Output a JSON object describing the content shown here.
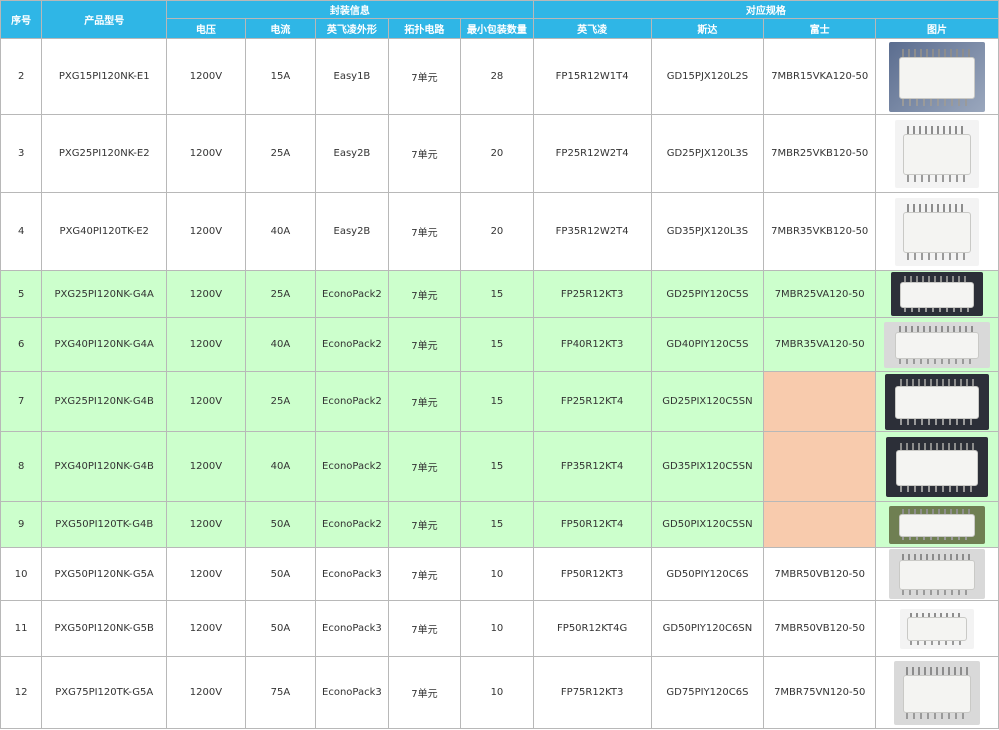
{
  "headers": {
    "no": "序号",
    "model": "产品型号",
    "package_info": "封装信息",
    "corresponding_specs": "对应规格",
    "voltage": "电压",
    "current": "电流",
    "infineon_package": "英飞凌外形",
    "topology": "拓扑电路",
    "min_pack_qty": "最小包装数量",
    "infineon": "英飞凌",
    "starpower": "斯达",
    "fuji": "富士",
    "picture": "图片"
  },
  "rows": [
    {
      "no": "2",
      "model": "PXG15PI120NK-E1",
      "voltage": "1200V",
      "current": "15A",
      "package": "Easy1B",
      "topology": "7单元",
      "qty": "28",
      "infineon": "FP15R12W1T4",
      "starpower": "GD15PJX120L2S",
      "fuji": "7MBR15VKA120-50",
      "image": "igbt-module-easy1b-photo"
    },
    {
      "no": "3",
      "model": "PXG25PI120NK-E2",
      "voltage": "1200V",
      "current": "25A",
      "package": "Easy2B",
      "topology": "7单元",
      "qty": "20",
      "infineon": "FP25R12W2T4",
      "starpower": "GD25PJX120L3S",
      "fuji": "7MBR25VKB120-50",
      "image": "igbt-module-easy2b-photo"
    },
    {
      "no": "4",
      "model": "PXG40PI120TK-E2",
      "voltage": "1200V",
      "current": "40A",
      "package": "Easy2B",
      "topology": "7单元",
      "qty": "20",
      "infineon": "FP35R12W2T4",
      "starpower": "GD35PJX120L3S",
      "fuji": "7MBR35VKB120-50",
      "image": "igbt-module-easy2b-photo"
    },
    {
      "no": "5",
      "model": "PXG25PI120NK-G4A",
      "voltage": "1200V",
      "current": "25A",
      "package": "EconoPack2",
      "topology": "7单元",
      "qty": "15",
      "infineon": "FP25R12KT3",
      "starpower": "GD25PIY120C5S",
      "fuji": "7MBR25VA120-50",
      "image": "igbt-module-econopack2-photo"
    },
    {
      "no": "6",
      "model": "PXG40PI120NK-G4A",
      "voltage": "1200V",
      "current": "40A",
      "package": "EconoPack2",
      "topology": "7单元",
      "qty": "15",
      "infineon": "FP40R12KT3",
      "starpower": "GD40PIY120C5S",
      "fuji": "7MBR35VA120-50",
      "image": "igbt-module-econopack2-photo"
    },
    {
      "no": "7",
      "model": "PXG25PI120NK-G4B",
      "voltage": "1200V",
      "current": "25A",
      "package": "EconoPack2",
      "topology": "7单元",
      "qty": "15",
      "infineon": "FP25R12KT4",
      "starpower": "GD25PIX120C5SN",
      "fuji": "",
      "image": "igbt-module-econopack2-photo"
    },
    {
      "no": "8",
      "model": "PXG40PI120NK-G4B",
      "voltage": "1200V",
      "current": "40A",
      "package": "EconoPack2",
      "topology": "7单元",
      "qty": "15",
      "infineon": "FP35R12KT4",
      "starpower": "GD35PIX120C5SN",
      "fuji": "",
      "image": "igbt-module-econopack2-photo"
    },
    {
      "no": "9",
      "model": "PXG50PI120TK-G4B",
      "voltage": "1200V",
      "current": "50A",
      "package": "EconoPack2",
      "topology": "7单元",
      "qty": "15",
      "infineon": "FP50R12KT4",
      "starpower": "GD50PIX120C5SN",
      "fuji": "",
      "image": "igbt-module-econopack2-photo"
    },
    {
      "no": "10",
      "model": "PXG50PI120NK-G5A",
      "voltage": "1200V",
      "current": "50A",
      "package": "EconoPack3",
      "topology": "7单元",
      "qty": "10",
      "infineon": "FP50R12KT3",
      "starpower": "GD50PIY120C6S",
      "fuji": "7MBR50VB120-50",
      "image": "igbt-module-econopack3-photo"
    },
    {
      "no": "11",
      "model": "PXG50PI120NK-G5B",
      "voltage": "1200V",
      "current": "50A",
      "package": "EconoPack3",
      "topology": "7单元",
      "qty": "10",
      "infineon": "FP50R12KT4G",
      "starpower": "GD50PIY120C6SN",
      "fuji": "7MBR50VB120-50",
      "image": "igbt-module-econopack3-photo"
    },
    {
      "no": "12",
      "model": "PXG75PI120TK-G5A",
      "voltage": "1200V",
      "current": "75A",
      "package": "EconoPack3",
      "topology": "7单元",
      "qty": "10",
      "infineon": "FP75R12KT3",
      "starpower": "GD75PIY120C6S",
      "fuji": "7MBR75VN120-50",
      "image": "igbt-module-econopack3-photo"
    }
  ],
  "colors": {
    "header_bg": "#2fb6e6",
    "highlight_row_bg": "#ccffcc",
    "missing_fuji_bg": "#f8cbad"
  }
}
